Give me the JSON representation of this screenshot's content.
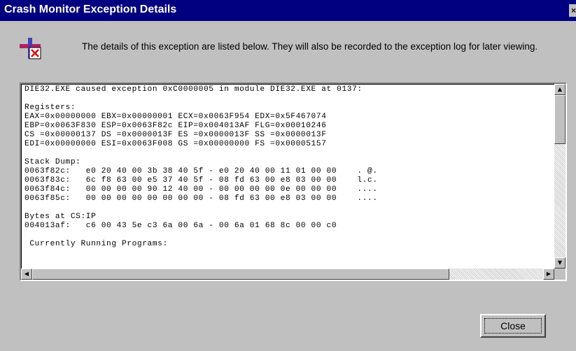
{
  "window": {
    "title": "Crash Monitor Exception Details",
    "close_glyph": "×"
  },
  "icon": "crash-exception-icon",
  "message": "The details of this exception are listed below.  They will also be recorded to the exception log for later viewing.",
  "details": {
    "lines": [
      "DIE32.EXE caused exception 0xC0000005 in module DIE32.EXE at 0137:",
      "",
      "Registers:",
      "EAX=0x00000000 EBX=0x00000001 ECX=0x0063F954 EDX=0x5F467074",
      "EBP=0x0063F830 ESP=0x0063F82c EIP=0x004013AF FLG=0x00010246",
      "CS =0x00000137 DS =0x0000013F ES =0x0000013F SS =0x0000013F",
      "EDI=0x00000000 ESI=0x0063F008 GS =0x00000000 FS =0x00005157",
      "",
      "Stack Dump:",
      "0063f82c:   e0 20 40 00 3b 38 40 5f - e0 20 40 00 11 01 00 00    . @.",
      "0063f83c:   6c f8 63 00 e5 37 40 5f - 08 fd 63 00 e8 03 00 00    l.c.",
      "0063f84c:   00 00 00 00 90 12 40 00 - 00 00 00 00 0e 00 00 00    ....",
      "0063f85c:   00 00 00 00 00 00 00 00 - 08 fd 63 00 e8 03 00 00    ....",
      "",
      "Bytes at CS:IP",
      "004013af:   c6 00 43 5e c3 6a 00 6a - 00 6a 01 68 8c 00 00 c0",
      "",
      " Currently Running Programs:"
    ]
  },
  "scrollbar": {
    "up_arrow": "▲",
    "down_arrow": "▼",
    "left_arrow": "◀",
    "right_arrow": "▶"
  },
  "buttons": {
    "close_label": "Close"
  },
  "colors": {
    "titlebar": "#000080",
    "face": "#c0c0c0",
    "text_area": "#ffffff"
  }
}
